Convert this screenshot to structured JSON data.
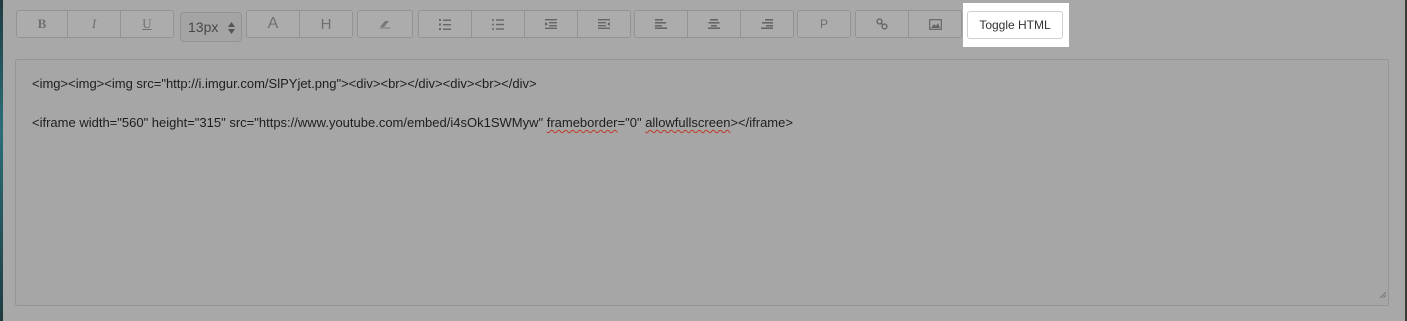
{
  "toolbar": {
    "bold_label": "B",
    "italic_label": "I",
    "underline_label": "U",
    "font_size_value": "13px",
    "font_color_label": "A",
    "highlight_label": "H",
    "paragraph_label": "P",
    "toggle_html_label": "Toggle HTML"
  },
  "editor": {
    "line1_text": "<img><img><img src=\"http://i.imgur.com/SlPYjet.png\"><div><br></div><div><br></div>",
    "line2_part1": "<iframe width=\"560\" height=\"315\" src=\"https://www.youtube.com/embed/i4sOk1SWMyw\" ",
    "line2_spell1": "frameborder",
    "line2_part2": "=\"0\" ",
    "line2_spell2": "allowfullscreen",
    "line2_part3": "></iframe>"
  },
  "icons": {
    "eraser": "eraser-icon",
    "ordered_list": "ordered-list-icon",
    "unordered_list": "unordered-list-icon",
    "outdent": "outdent-icon",
    "indent": "indent-icon",
    "align_left": "align-left-icon",
    "align_center": "align-center-icon",
    "align_right": "align-right-icon",
    "link": "link-icon",
    "image": "image-icon"
  },
  "colors": {
    "overlay_background": "#a8a8a8",
    "highlight": "#ffffff",
    "spellcheck": "#c0392b"
  }
}
